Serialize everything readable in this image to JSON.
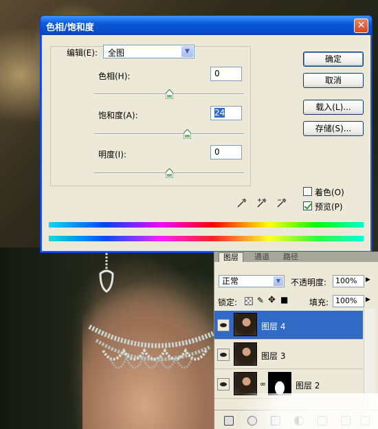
{
  "dialog": {
    "title": "色相/饱和度",
    "close_glyph": "✕",
    "edit_label": "编辑(E):",
    "edit_value": "全图",
    "hue_label": "色相(H):",
    "hue_value": "0",
    "hue_level": 0,
    "saturation_label": "饱和度(A):",
    "saturation_value": "24",
    "saturation_level": 24,
    "lightness_label": "明度(I):",
    "lightness_value": "0",
    "lightness_level": 0,
    "buttons": {
      "ok": "确定",
      "cancel": "取消",
      "load": "载入(L)...",
      "save": "存储(S)..."
    },
    "colorize_label": "着色(O)",
    "colorize_checked": false,
    "preview_label": "预览(P)",
    "preview_checked": true,
    "pipette_icons": [
      "eyedropper-icon",
      "eyedropper-plus-icon",
      "eyedropper-minus-icon"
    ]
  },
  "layers_panel": {
    "tabs": [
      "图层",
      "通道",
      "路径"
    ],
    "blend_mode": "正常",
    "opacity_label": "不透明度:",
    "opacity_value": "100%",
    "lock_label": "锁定:",
    "fill_label": "填充:",
    "fill_value": "100%",
    "layers": [
      {
        "name": "图层 4",
        "active": true
      },
      {
        "name": "图层 3",
        "active": false
      },
      {
        "name": "图层 2",
        "active": false
      }
    ]
  },
  "colors": {
    "titlebar": "#0a5ad6",
    "selection": "#316ac5",
    "dialog_bg": "#ece9d8"
  }
}
